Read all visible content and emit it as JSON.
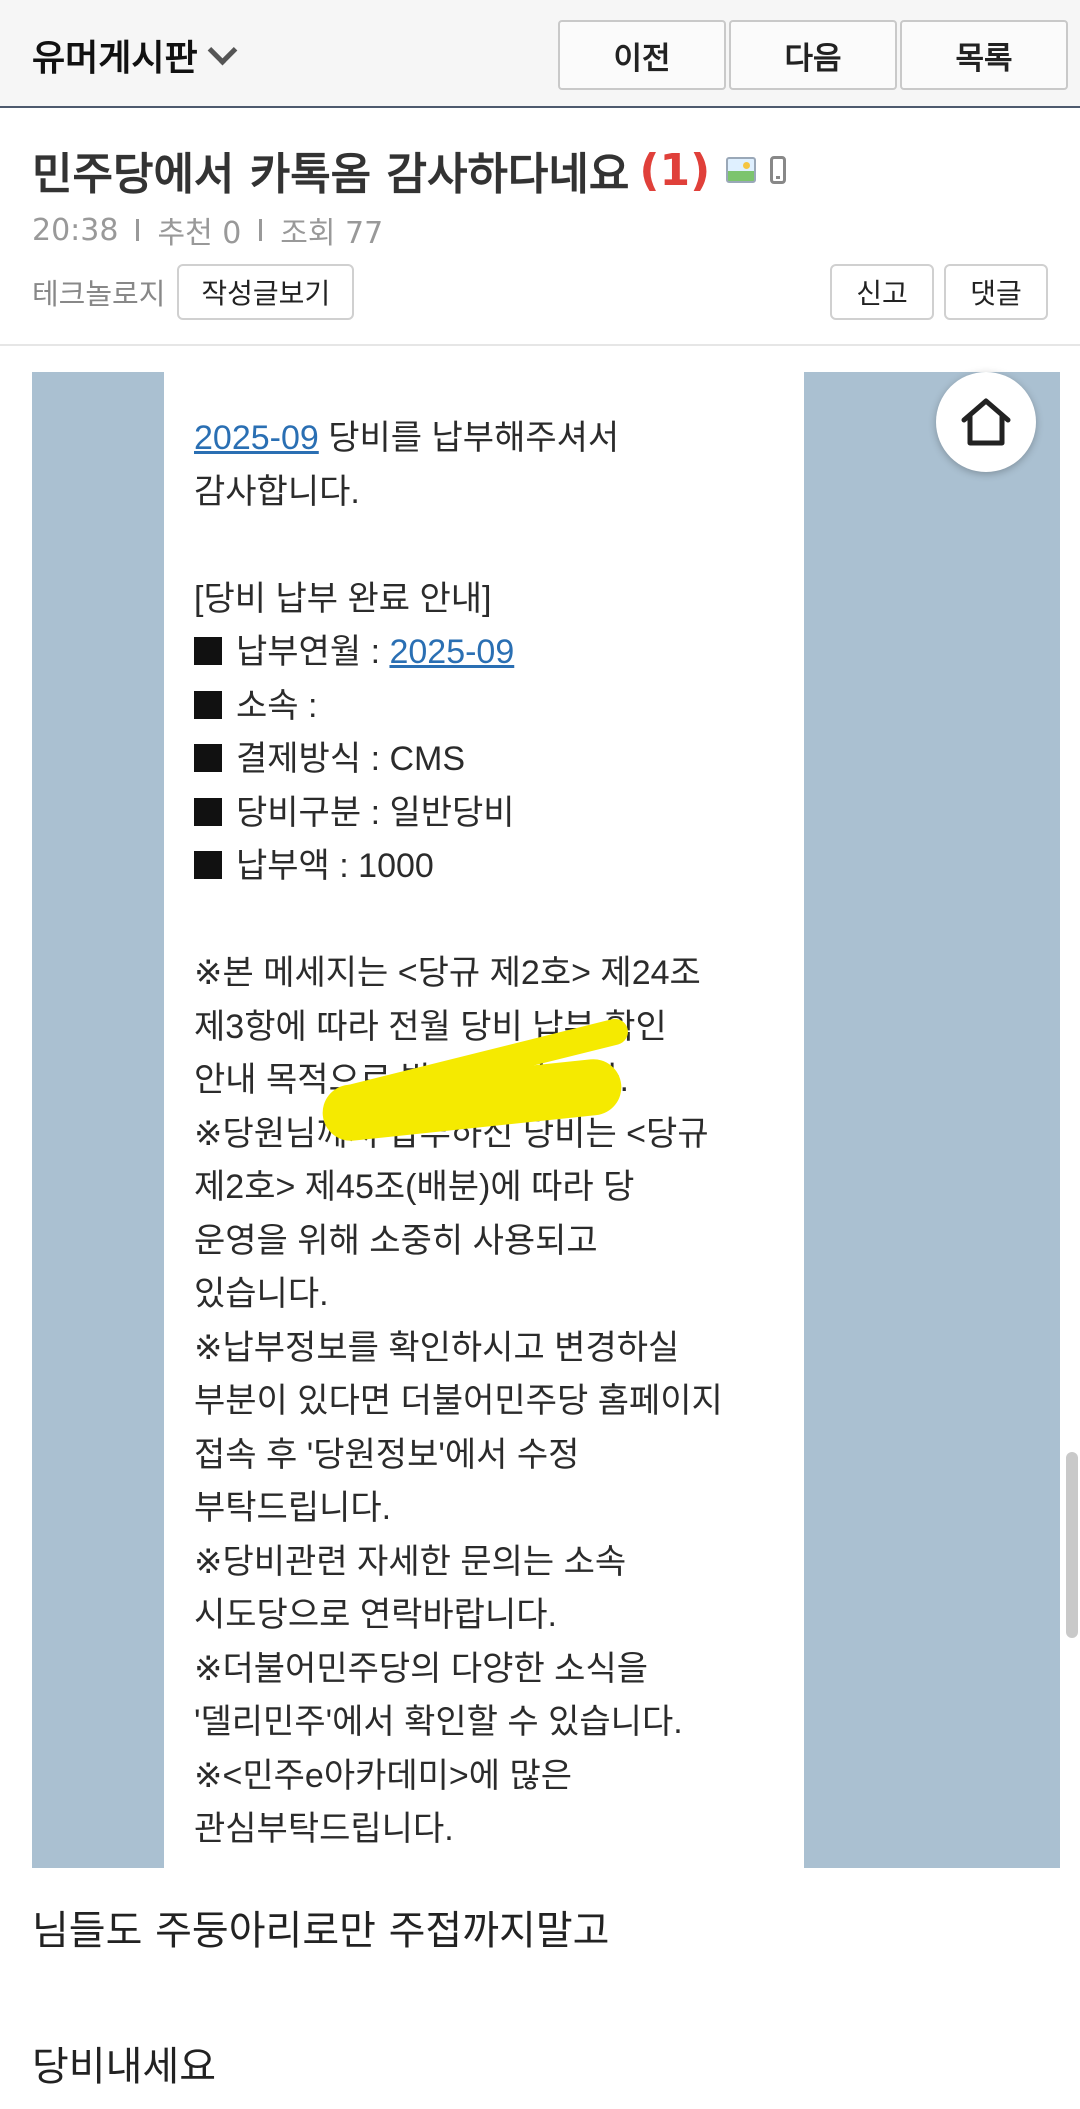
{
  "nav": {
    "board_name": "유머게시판",
    "prev": "이전",
    "next": "다음",
    "list": "목록"
  },
  "post": {
    "title": "민주당에서 카톡옴 감사하다네요",
    "comment_count": "(1)",
    "time": "20:38",
    "recommend": "추천 0",
    "views": "조회 77",
    "category": "테크놀로지",
    "view_posts": "작성글보기",
    "report": "신고",
    "reply": "댓글"
  },
  "image_message": {
    "l1_link": "2025-09",
    "l1_rest": " 당비를 납부해주셔서",
    "l2": "감사합니다.",
    "l3": "[당비 납부 완료 안내]",
    "l4_label": "납부연월 : ",
    "l4_link": "2025-09",
    "l5_label": "소속 : ",
    "l6": "결제방식 : CMS",
    "l7": "당비구분 : 일반당비",
    "l8": "납부액 : 1000",
    "l9": "※본 메세지는 <당규 제2호> 제24조",
    "l10": "제3항에 따라 전월 당비 납부 확인",
    "l11": "안내 목적으로 발송되었습니다.",
    "l12": "※당원님께서 납부하신 당비는 <당규",
    "l13": "제2호> 제45조(배분)에 따라 당",
    "l14": "운영을 위해 소중히 사용되고",
    "l15": "있습니다.",
    "l16": "※납부정보를 확인하시고 변경하실",
    "l17": "부분이 있다면 더불어민주당 홈페이지",
    "l18": "접속 후 '당원정보'에서 수정",
    "l19": "부탁드립니다.",
    "l20": "※당비관련 자세한 문의는 소속",
    "l21": "시도당으로 연락바랍니다.",
    "l22": "※더불어민주당의 다양한 소식을",
    "l23": "'델리민주'에서 확인할 수 있습니다.",
    "l24": "※<민주e아카데미>에 많은",
    "l25": "관심부탁드립니다."
  },
  "body": {
    "line1": "님들도 주둥아리로만 주접까지말고",
    "line2": "당비내세요"
  },
  "colors": {
    "accent_red": "#e0403a",
    "link_blue": "#2a6fb3",
    "image_bg": "#aac0d1",
    "redaction_yellow": "#f5ea00"
  },
  "icons": [
    "chevron-down-icon",
    "image-icon",
    "mobile-icon",
    "home-icon"
  ]
}
